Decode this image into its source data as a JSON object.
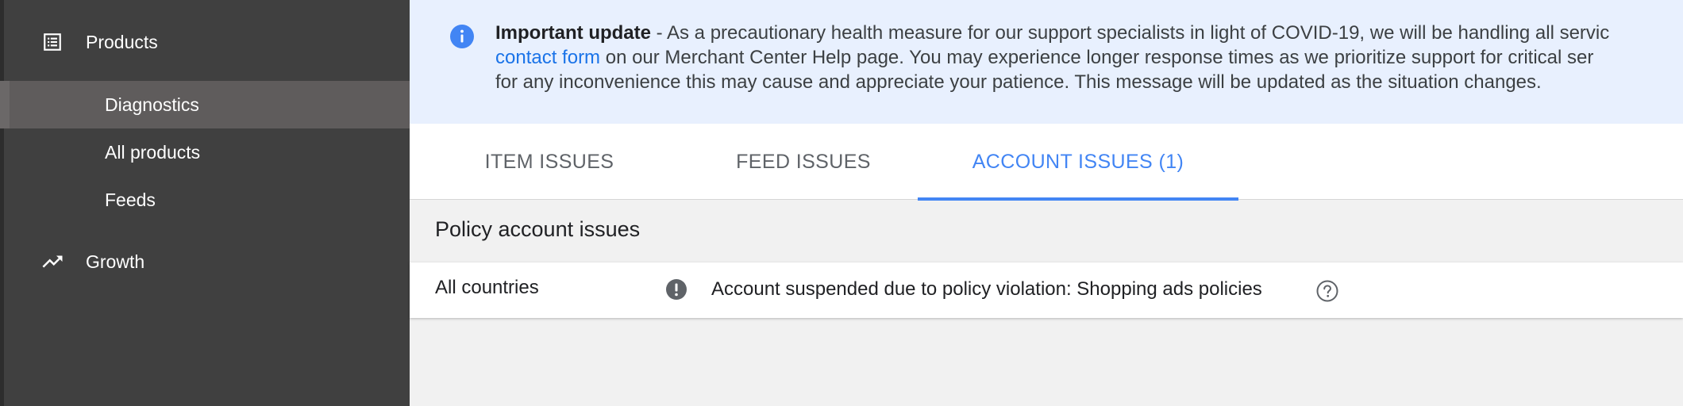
{
  "sidebar": {
    "sections": [
      {
        "label": "Products",
        "icon": "list-icon"
      },
      {
        "label": "Growth",
        "icon": "trending-up-icon"
      }
    ],
    "items": [
      {
        "label": "Diagnostics",
        "active": true
      },
      {
        "label": "All products",
        "active": false
      },
      {
        "label": "Feeds",
        "active": false
      }
    ]
  },
  "banner": {
    "icon": "info-icon",
    "title": "Important update",
    "line1_text": " - As a precautionary health measure for our support specialists in light of COVID-19, we will be handling all servic",
    "link_text": "contact form",
    "line2_text": " on our Merchant Center Help page. You may experience longer response times as we prioritize support for critical ser",
    "line3_text": "for any inconvenience this may cause and appreciate your patience. This message will be updated as the situation changes."
  },
  "tabs": [
    {
      "label": "ITEM ISSUES",
      "active": false
    },
    {
      "label": "FEED ISSUES",
      "active": false
    },
    {
      "label": "ACCOUNT ISSUES (1)",
      "active": true
    }
  ],
  "section_title": "Policy account issues",
  "issue": {
    "region": "All countries",
    "text": "Account suspended due to policy violation: Shopping ads policies",
    "status_icon": "alert-icon",
    "help_icon": "help-icon"
  },
  "colors": {
    "sidebar_bg": "#404040",
    "banner_bg": "#e8f0fe",
    "accent": "#4285f4",
    "link": "#1a73e8"
  }
}
